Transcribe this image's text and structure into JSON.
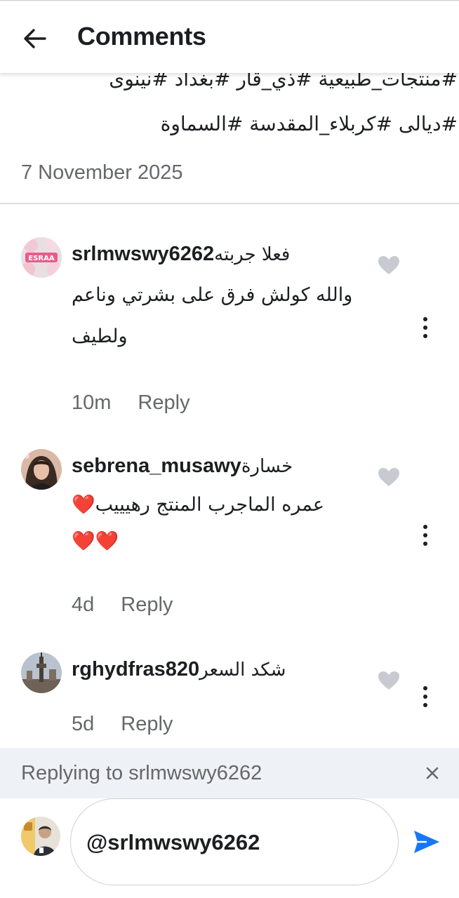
{
  "header": {
    "title": "Comments",
    "back_icon": "arrow-left-icon"
  },
  "post": {
    "caption_line1": "#منتجات_طبيعية #ذي_قار #بغداد #نينوى",
    "caption_line2": "#ديالى #كربلاء_المقدسة #السماوة",
    "date": "7 November 2025"
  },
  "comments": [
    {
      "username": "srlmwswy6262",
      "text_line1": "فعلا جربته",
      "text_line2": "والله كولش فرق على بشرتي وناعم",
      "text_line3": "ولطيف",
      "time": "10m",
      "reply_label": "Reply"
    },
    {
      "username": "sebrena_musawy",
      "text_line1": "خسارة",
      "text_line2": "عمره الماجرب المنتج رهيييب❤️",
      "text_line3": "❤️❤️",
      "time": "4d",
      "reply_label": "Reply"
    },
    {
      "username": "rghydfras820",
      "text_line1": "شكد السعر",
      "time": "5d",
      "reply_label": "Reply"
    }
  ],
  "reply_bar": {
    "text": "Replying to srlmwswy6262",
    "close_icon": "close-icon"
  },
  "composer": {
    "input_value": "@srlmwswy6262",
    "send_icon": "send-icon"
  },
  "colors": {
    "accent": "#1877f2",
    "secondary_text": "#65676b",
    "reply_bar_bg": "#eef1f5"
  }
}
